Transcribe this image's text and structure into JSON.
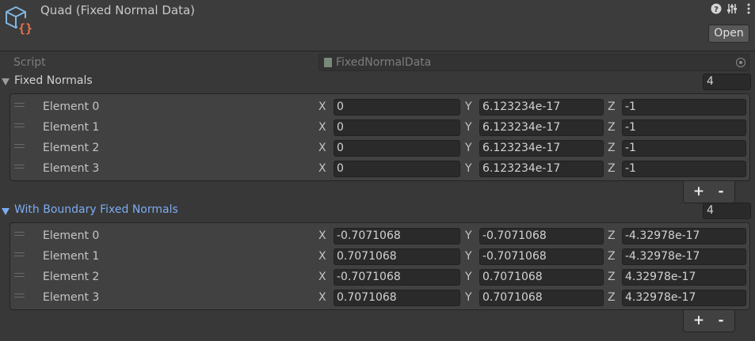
{
  "header": {
    "title": "Quad (Fixed Normal Data)",
    "open_label": "Open",
    "icons": [
      "help-icon",
      "preset-icon",
      "kebab-menu-icon"
    ]
  },
  "script": {
    "label": "Script",
    "value": "FixedNormalData"
  },
  "fixed_normals": {
    "title": "Fixed Normals",
    "size": "4",
    "axis_labels": [
      "X",
      "Y",
      "Z"
    ],
    "elements": [
      {
        "label": "Element 0",
        "x": "0",
        "y": "6.123234e-17",
        "z": "-1"
      },
      {
        "label": "Element 1",
        "x": "0",
        "y": "6.123234e-17",
        "z": "-1"
      },
      {
        "label": "Element 2",
        "x": "0",
        "y": "6.123234e-17",
        "z": "-1"
      },
      {
        "label": "Element 3",
        "x": "0",
        "y": "6.123234e-17",
        "z": "-1"
      }
    ],
    "add_label": "+",
    "remove_label": "-"
  },
  "boundary_normals": {
    "title": "With Boundary Fixed Normals",
    "size": "4",
    "axis_labels": [
      "X",
      "Y",
      "Z"
    ],
    "elements": [
      {
        "label": "Element 0",
        "x": "-0.7071068",
        "y": "-0.7071068",
        "z": "-4.32978e-17"
      },
      {
        "label": "Element 1",
        "x": "0.7071068",
        "y": "-0.7071068",
        "z": "-4.32978e-17"
      },
      {
        "label": "Element 2",
        "x": "-0.7071068",
        "y": "0.7071068",
        "z": "4.32978e-17"
      },
      {
        "label": "Element 3",
        "x": "0.7071068",
        "y": "0.7071068",
        "z": "4.32978e-17"
      }
    ],
    "add_label": "+",
    "remove_label": "-"
  }
}
